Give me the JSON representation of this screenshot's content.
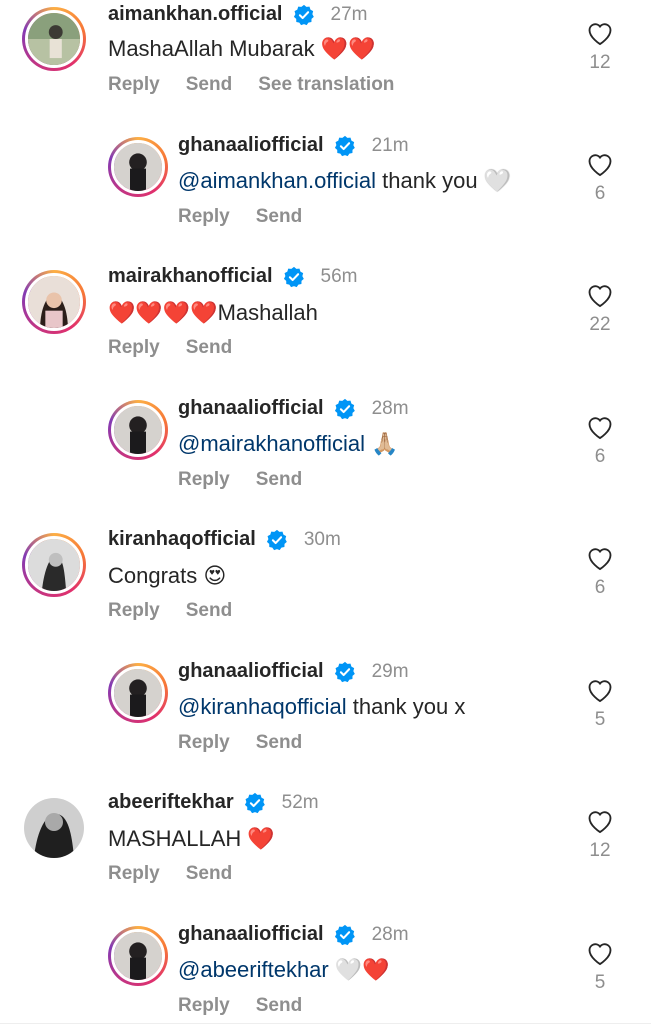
{
  "comments": [
    {
      "username": "aimankhan.official",
      "time": "27m",
      "text": "MashaAllah Mubarak",
      "emoji": "❤️❤️",
      "actions": [
        "Reply",
        "Send",
        "See translation"
      ],
      "likes": "12"
    },
    {
      "username": "ghanaaliofficial",
      "time": "21m",
      "mention": "@aimankhan.official",
      "text": " thank you",
      "emoji": "🤍",
      "actions": [
        "Reply",
        "Send"
      ],
      "likes": "6"
    },
    {
      "username": "mairakhanofficial",
      "time": "56m",
      "emoji": "❤️❤️❤️❤️",
      "text": "Mashallah",
      "actions": [
        "Reply",
        "Send"
      ],
      "likes": "22"
    },
    {
      "username": "ghanaaliofficial",
      "time": "28m",
      "mention": "@mairakhanofficial",
      "emoji": "🙏🏼",
      "actions": [
        "Reply",
        "Send"
      ],
      "likes": "6"
    },
    {
      "username": "kiranhaqofficial",
      "time": "30m",
      "text": "Congrats",
      "emoji": "😍",
      "actions": [
        "Reply",
        "Send"
      ],
      "likes": "6"
    },
    {
      "username": "ghanaaliofficial",
      "time": "29m",
      "mention": "@kiranhaqofficial",
      "text": " thank you x",
      "actions": [
        "Reply",
        "Send"
      ],
      "likes": "5"
    },
    {
      "username": "abeeriftekhar",
      "time": "52m",
      "text": "MASHALLAH",
      "emoji": "❤️",
      "actions": [
        "Reply",
        "Send"
      ],
      "likes": "12"
    },
    {
      "username": "ghanaaliofficial",
      "time": "28m",
      "mention": "@abeeriftekhar",
      "emoji": "🤍❤️",
      "actions": [
        "Reply",
        "Send"
      ],
      "likes": "5"
    }
  ],
  "colors": {
    "verified": "#0095f6",
    "mention": "#00376b",
    "muted": "#8e8e8e",
    "heart": "#ed2f3a"
  },
  "icons": {
    "like": "heart-outline-icon",
    "verified": "verified-badge-icon"
  }
}
